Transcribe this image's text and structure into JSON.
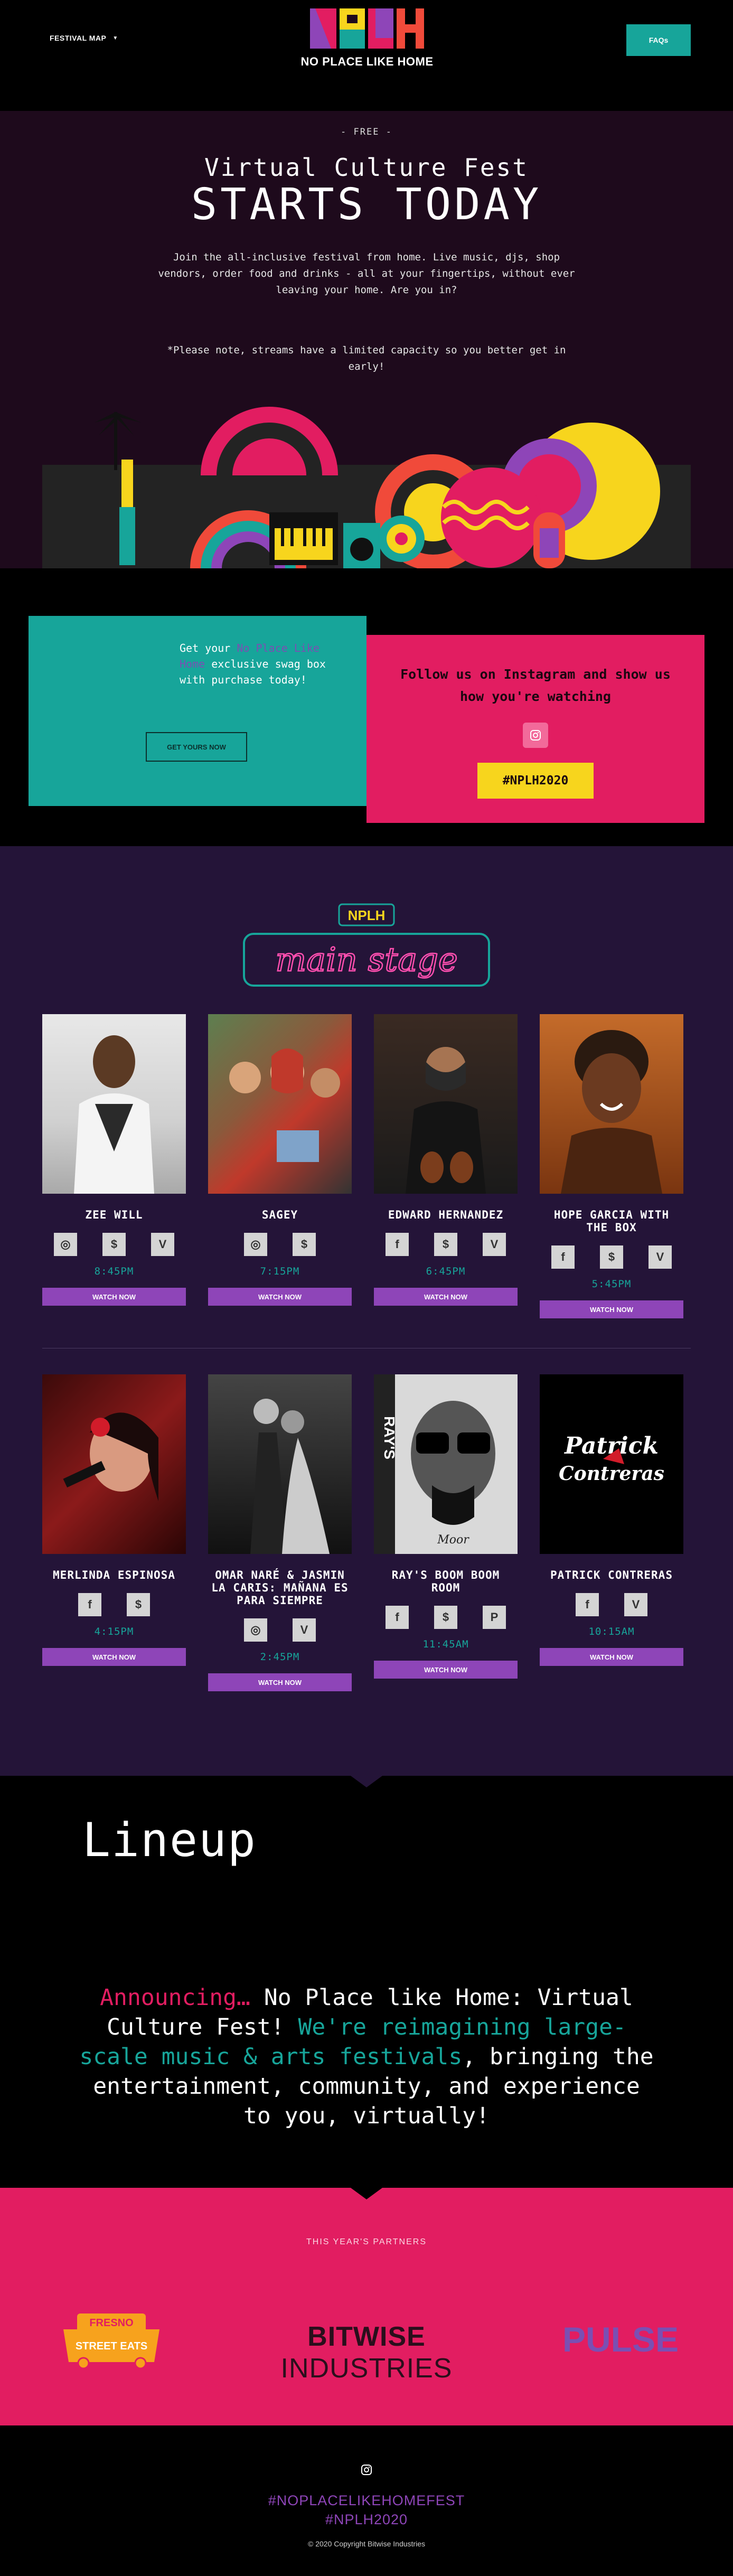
{
  "header": {
    "festival_map": "FESTIVAL MAP",
    "logo_letters": "NPLH",
    "logo_tagline": "NO PLACE LIKE HOME",
    "faq": "FAQs"
  },
  "hero": {
    "free": "- FREE -",
    "title": "Virtual Culture Fest",
    "subtitle": "STARTS TODAY",
    "intro": "Join the all-inclusive festival from home. Live music, djs, shop vendors, order food and drinks - all at your fingertips, without ever leaving your home. Are you in?",
    "note": "*Please note, streams have a limited capacity so you better get in early!"
  },
  "promo": {
    "swag_pre": "Get your ",
    "swag_highlight": "No Place Like Home",
    "swag_post": " exclusive swag box with purchase today!",
    "swag_button": "GET YOURS NOW",
    "insta_text": "Follow us on Instagram and show us how you're watching",
    "hashtag": "#NPLH2020"
  },
  "stage": {
    "logo_letters": "NPLH",
    "title": "main stage",
    "watch_label": "WATCH NOW",
    "artists": [
      {
        "name": "ZEE WILL",
        "time": "8:45PM",
        "icons": [
          "instagram",
          "cash",
          "venmo"
        ]
      },
      {
        "name": "SAGEY",
        "time": "7:15PM",
        "icons": [
          "instagram",
          "cash"
        ]
      },
      {
        "name": "EDWARD HERNANDEZ",
        "time": "6:45PM",
        "icons": [
          "facebook",
          "cash",
          "venmo"
        ]
      },
      {
        "name": "HOPE GARCIA WITH THE BOX",
        "time": "5:45PM",
        "icons": [
          "facebook",
          "cash",
          "venmo"
        ]
      },
      {
        "name": "MERLINDA ESPINOSA",
        "time": "4:15PM",
        "icons": [
          "facebook",
          "cash"
        ]
      },
      {
        "name": "OMAR NARÉ & JASMIN LA CARIS: MAÑANA ES PARA SIEMPRE",
        "time": "2:45PM",
        "icons": [
          "instagram",
          "venmo"
        ]
      },
      {
        "name": "RAY'S BOOM BOOM ROOM",
        "time": "11:45AM",
        "icons": [
          "facebook",
          "cash",
          "paypal"
        ]
      },
      {
        "name": "PATRICK CONTRERAS",
        "time": "10:15AM",
        "icons": [
          "facebook",
          "venmo"
        ]
      }
    ],
    "photo_texts": {
      "ray_side": "RAY'S",
      "ray_caption": "Moor",
      "patrick_logo": "Patrick Contreras"
    }
  },
  "lineup": {
    "title": "Lineup",
    "announce_red": "Announcing…",
    "announce_1": " No Place like Home: Virtual Culture Fest! ",
    "announce_teal": "We're reimagining large-scale music & arts festivals",
    "announce_2": ", bringing the entertainment, community, and experience to you, virtually!"
  },
  "partners": {
    "title": "THIS YEAR'S PARTNERS",
    "fresno_top": "FRESNO",
    "fresno_bottom": "STREET EATS",
    "bitwise_bold": "BITWISE",
    "bitwise_light": " INDUSTRIES",
    "pulse": "PULSE"
  },
  "footer": {
    "tag1": "#NOPLACELIKEHOMEFEST",
    "tag2": "#NPLH2020",
    "copyright": "© 2020 Copyright Bitwise Industries"
  },
  "colors": {
    "teal": "#17a59a",
    "pink": "#e21d61",
    "purple": "#8e45b8",
    "yellow": "#f7d51d",
    "stage_bg": "#241438",
    "hero_bg": "#1e0a1c"
  }
}
